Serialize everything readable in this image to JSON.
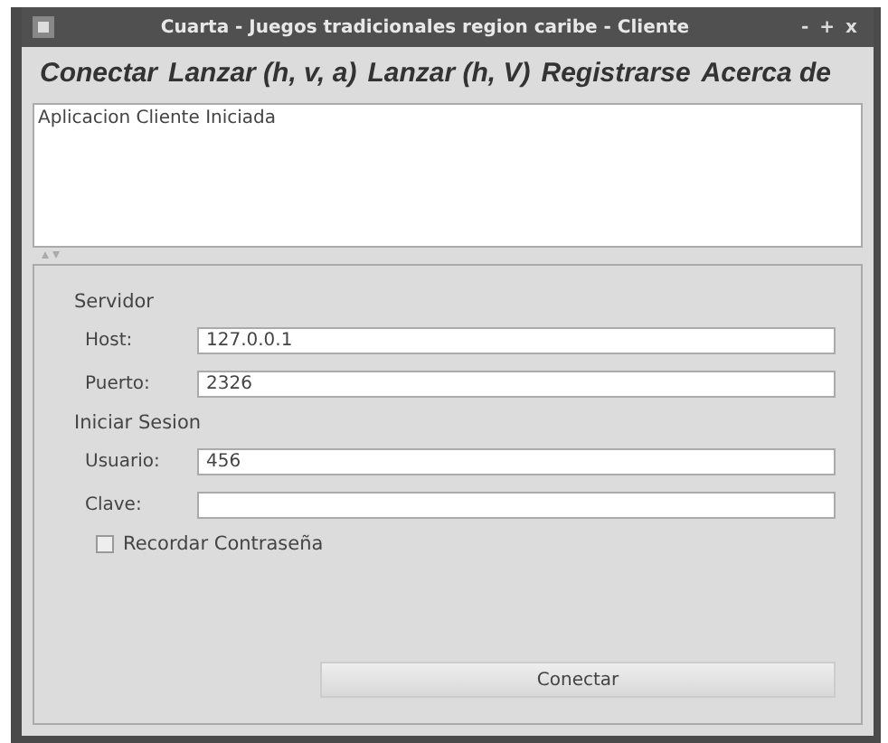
{
  "window": {
    "title": "Cuarta - Juegos tradicionales region caribe - Cliente",
    "controls": [
      "-",
      "+",
      "x"
    ]
  },
  "menu": [
    "Conectar",
    "Lanzar (h, v, a)",
    "Lanzar (h, V)",
    "Registrarse",
    "Acerca de"
  ],
  "log": {
    "text": "Aplicacion Cliente Iniciada"
  },
  "groups": [
    {
      "title": "Servidor",
      "fields": [
        {
          "label": "Host:",
          "value": "127.0.0.1"
        },
        {
          "label": "Puerto:",
          "value": "2326"
        }
      ]
    },
    {
      "title": "Iniciar Sesion",
      "fields": [
        {
          "label": "Usuario:",
          "value": "456"
        },
        {
          "label": "Clave:"
        }
      ]
    }
  ],
  "remember": {
    "label": "Recordar Contraseña",
    "checked": false
  },
  "button": "Conectar"
}
